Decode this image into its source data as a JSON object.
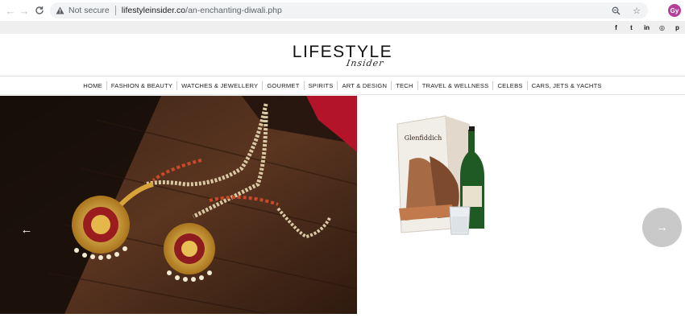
{
  "browser": {
    "security_label": "Not secure",
    "url_host": "lifestyleinsider.co",
    "url_path": "/an-enchanting-diwali.php",
    "profile_initials": "Gy",
    "profile_color": "#b43f98"
  },
  "social": {
    "icons": [
      "facebook-icon",
      "twitter-icon",
      "linkedin-icon",
      "instagram-icon",
      "pinterest-icon"
    ],
    "glyphs": [
      "f",
      "t",
      "in",
      "◎",
      "p"
    ]
  },
  "logo": {
    "main": "LIFESTYLE",
    "sub": "Insider"
  },
  "menu": {
    "items": [
      "HOME",
      "FASHION & BEAUTY",
      "WATCHES & JEWELLERY",
      "GOURMET",
      "SPIRITS",
      "ART & DESIGN",
      "TECH",
      "TRAVEL & WELLNESS",
      "CELEBS",
      "CARS, JETS & YACHTS"
    ]
  },
  "slider": {
    "prev_glyph": "←",
    "next_glyph": "→",
    "product_brand": "Glenfiddich"
  },
  "colors": {
    "social_bar": "#efefef",
    "arrow_circle": "#c9c9c9"
  }
}
